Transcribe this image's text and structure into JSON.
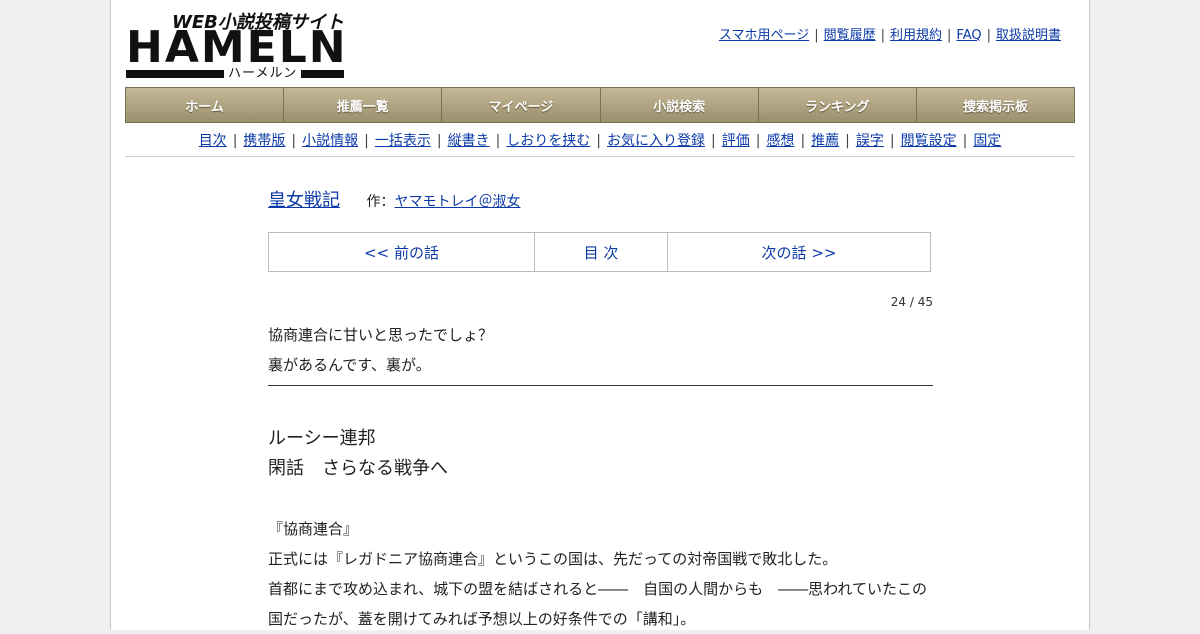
{
  "logo": {
    "word": "HAMELN",
    "tagline": "WEB小説投稿サイト",
    "kana": "ハーメルン"
  },
  "toplinks": [
    "スマホ用ページ",
    "閲覧履歴",
    "利用規約",
    "FAQ",
    "取扱説明書"
  ],
  "mainnav": [
    "ホーム",
    "推薦一覧",
    "マイページ",
    "小説検索",
    "ランキング",
    "捜索掲示板"
  ],
  "subnav": [
    "目次",
    "携帯版",
    "小説情報",
    "一括表示",
    "縦書き",
    "しおりを挟む",
    "お気に入り登録",
    "評価",
    "感想",
    "推薦",
    "誤字",
    "閲覧設定",
    "固定"
  ],
  "novel": {
    "title": "皇女戦記",
    "author_prefix": "作：",
    "author": "ヤマモトレイ＠淑女"
  },
  "pager": {
    "prev": "<< 前の話",
    "toc": "目 次",
    "next": "次の話 >>"
  },
  "counter": "24 / 45",
  "preface": [
    "協商連合に甘いと思ったでしょ？",
    "裏があるんです、裏が。"
  ],
  "chapter": [
    "ルーシー連邦",
    "閑話　さらなる戦争へ"
  ],
  "body": [
    "『協商連合』",
    "正式には『レガドニア協商連合』というこの国は、先だっての対帝国戦で敗北した。",
    "首都にまで攻め込まれ、城下の盟を結ばされると――　自国の人間からも　――思われていたこの",
    "国だったが、蓋を開けてみれば予想以上の好条件での「講和」。"
  ]
}
